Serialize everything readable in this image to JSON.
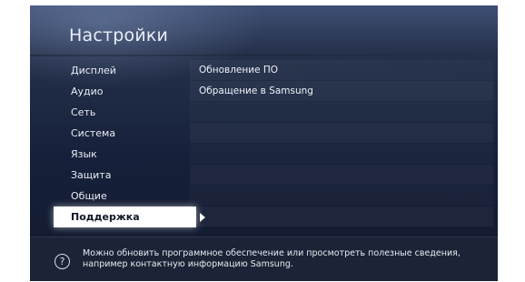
{
  "header": {
    "title": "Настройки"
  },
  "menu": {
    "items": [
      {
        "label": "Дисплей"
      },
      {
        "label": "Аудио"
      },
      {
        "label": "Сеть"
      },
      {
        "label": "Система"
      },
      {
        "label": "Язык"
      },
      {
        "label": "Защита"
      },
      {
        "label": "Общие"
      },
      {
        "label": "Поддержка",
        "selected": true
      }
    ]
  },
  "submenu": {
    "items": [
      {
        "label": "Обновление ПО"
      },
      {
        "label": "Обращение в Samsung"
      }
    ]
  },
  "footer": {
    "help_icon": "question-circle-icon",
    "help_symbol": "?",
    "text": "Можно обновить программное обеспечение или просмотреть полезные сведения, например контактную информацию Samsung."
  },
  "colors": {
    "background": "#16203a",
    "selected_background": "#ffffff",
    "selected_text": "#111827",
    "text": "#e8ecf4"
  }
}
